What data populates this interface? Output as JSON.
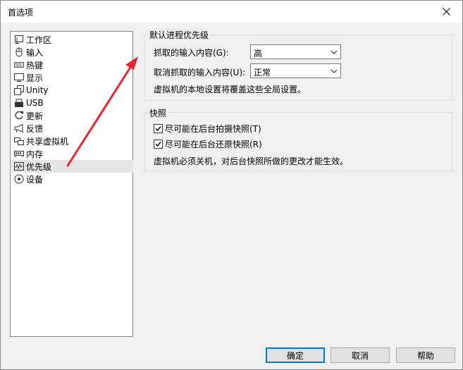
{
  "window": {
    "title": "首选项"
  },
  "sidebar": {
    "items": [
      {
        "label": "工作区",
        "icon": "workspace-icon"
      },
      {
        "label": "输入",
        "icon": "mouse-icon"
      },
      {
        "label": "热键",
        "icon": "keyboard-icon"
      },
      {
        "label": "显示",
        "icon": "monitor-icon"
      },
      {
        "label": "Unity",
        "icon": "unity-icon"
      },
      {
        "label": "USB",
        "icon": "usb-icon"
      },
      {
        "label": "更新",
        "icon": "refresh-icon"
      },
      {
        "label": "反馈",
        "icon": "megaphone-icon"
      },
      {
        "label": "共享虚拟机",
        "icon": "shared-vm-icon"
      },
      {
        "label": "内存",
        "icon": "memory-icon"
      },
      {
        "label": "优先级",
        "icon": "priority-icon",
        "selected": true
      },
      {
        "label": "设备",
        "icon": "device-icon"
      }
    ]
  },
  "priority_group": {
    "title": "默认进程优先级",
    "grabbed_label": "抓取的输入内容(G):",
    "grabbed_value": "高",
    "ungrabbed_label": "取消抓取的输入内容(U):",
    "ungrabbed_value": "正常",
    "note": "虚拟机的本地设置将覆盖这些全局设置。"
  },
  "snapshot_group": {
    "title": "快照",
    "take_background_label": "尽可能在后台拍摄快照(T)",
    "take_background_checked": true,
    "restore_background_label": "尽可能在后台还原快照(R)",
    "restore_background_checked": true,
    "note": "虚拟机必须关机，对后台快照所做的更改才能生效。"
  },
  "buttons": {
    "ok": "确定",
    "cancel": "取消",
    "help": "帮助"
  },
  "colors": {
    "annotation_arrow": "#e8262d",
    "default_button_border": "#0078d7"
  }
}
